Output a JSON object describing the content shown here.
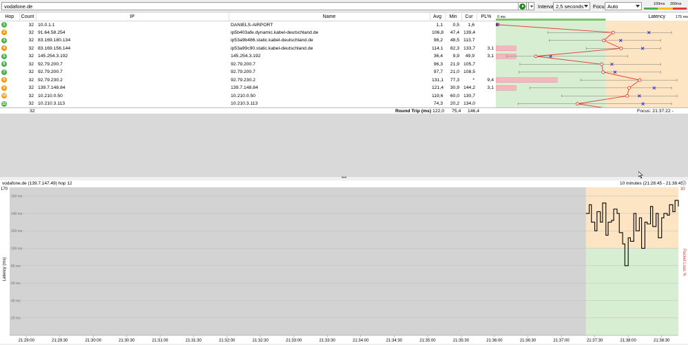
{
  "toolbar": {
    "target": "vodafone.de",
    "interval_label": "Interval",
    "interval_value": "2,5 seconds",
    "focus_label": "Focus",
    "focus_value": "Auto",
    "legend_100": "100ms",
    "legend_200": "200ms"
  },
  "columns": {
    "hop": "Hop",
    "count": "Count",
    "ip": "IP",
    "name": "Name",
    "avg": "Avg",
    "min": "Min",
    "cur": "Cur",
    "pl": "PL%",
    "latency": "Latency",
    "lat_min": "0 ms",
    "lat_max": "175 ms"
  },
  "hops": [
    {
      "hop": "1",
      "count": "32",
      "ip": "10.0.1.1",
      "name": "DANIELS-AIRPORT",
      "avg": "1,1",
      "min": "0,5",
      "cur": "1,6",
      "pl": "",
      "color": "#4caf50",
      "avg_v": 1.1,
      "min_v": 0.5,
      "cur_v": 1.6,
      "max_v": 3,
      "pl_v": 0
    },
    {
      "hop": "2",
      "count": "32",
      "ip": "91.64.58.254",
      "name": "ip5b403afe.dynamic.kabel-deutschland.de",
      "avg": "106,8",
      "min": "47,4",
      "cur": "139,4",
      "pl": "",
      "color": "#ff9800",
      "avg_v": 106.8,
      "min_v": 47.4,
      "cur_v": 139.4,
      "max_v": 160,
      "pl_v": 0
    },
    {
      "hop": "3",
      "count": "32",
      "ip": "83.169.180.134",
      "name": "ip53a9b486.static.kabel-deutschland.de",
      "avg": "98,2",
      "min": "48,5",
      "cur": "113,7",
      "pl": "",
      "color": "#4caf50",
      "avg_v": 98.2,
      "min_v": 48.5,
      "cur_v": 113.7,
      "max_v": 150,
      "pl_v": 0
    },
    {
      "hop": "4",
      "count": "32",
      "ip": "83.169.156.144",
      "name": "ip53a99c90.static.kabel-deutschland.de",
      "avg": "114,1",
      "min": "82,3",
      "cur": "133,7",
      "pl": "3,1",
      "color": "#ff9800",
      "avg_v": 114.1,
      "min_v": 82.3,
      "cur_v": 133.7,
      "max_v": 150,
      "pl_v": 3.1
    },
    {
      "hop": "5",
      "count": "32",
      "ip": "145.254.3.192",
      "name": "145.254.3.192",
      "avg": "36,4",
      "min": "9,9",
      "cur": "49,9",
      "pl": "3,1",
      "color": "#4caf50",
      "avg_v": 36.4,
      "min_v": 9.9,
      "cur_v": 49.9,
      "max_v": 120,
      "pl_v": 3.1
    },
    {
      "hop": "6",
      "count": "32",
      "ip": "92.79.200.7",
      "name": "92.79.200.7",
      "avg": "96,3",
      "min": "21,9",
      "cur": "105,7",
      "pl": "",
      "color": "#4caf50",
      "avg_v": 96.3,
      "min_v": 21.9,
      "cur_v": 105.7,
      "max_v": 150,
      "pl_v": 0
    },
    {
      "hop": "7",
      "count": "32",
      "ip": "92.79.200.7",
      "name": "92.79.200.7",
      "avg": "97,7",
      "min": "21,0",
      "cur": "108,5",
      "pl": "",
      "color": "#4caf50",
      "avg_v": 97.7,
      "min_v": 21.0,
      "cur_v": 108.5,
      "max_v": 150,
      "pl_v": 0
    },
    {
      "hop": "8",
      "count": "32",
      "ip": "92.79.230.2",
      "name": "92.79.230.2",
      "avg": "131,1",
      "min": "77,3",
      "cur": "*",
      "pl": "9,4",
      "color": "#ff9800",
      "avg_v": 131.1,
      "min_v": 77.3,
      "cur_v": null,
      "max_v": 165,
      "pl_v": 9.4
    },
    {
      "hop": "9",
      "count": "32",
      "ip": "139.7.148.84",
      "name": "139.7.148.84",
      "avg": "121,4",
      "min": "30,9",
      "cur": "144,2",
      "pl": "3,1",
      "color": "#ff9800",
      "avg_v": 121.4,
      "min_v": 30.9,
      "cur_v": 144.2,
      "max_v": 160,
      "pl_v": 3.1
    },
    {
      "hop": "10",
      "count": "32",
      "ip": "10.210.0.50",
      "name": "10.210.0.50",
      "avg": "119,6",
      "min": "60,0",
      "cur": "130,7",
      "pl": "",
      "color": "#ff9800",
      "avg_v": 119.6,
      "min_v": 60.0,
      "cur_v": 130.7,
      "max_v": 165,
      "pl_v": 0
    },
    {
      "hop": "11",
      "count": "32",
      "ip": "10.210.3.113",
      "name": "10.210.3.113",
      "avg": "74,3",
      "min": "20,2",
      "cur": "134,0",
      "pl": "",
      "color": "#4caf50",
      "avg_v": 74.3,
      "min_v": 20.2,
      "cur_v": 134.0,
      "max_v": 160,
      "pl_v": 0
    },
    {
      "hop": "12",
      "count": "32",
      "ip": "139.7.147.49",
      "name": "vodafone.de",
      "avg": "122,0",
      "min": "75,4",
      "cur": "146,4",
      "pl": "",
      "color": "#ff9800",
      "avg_v": 122.0,
      "min_v": 75.4,
      "cur_v": 146.4,
      "max_v": 165,
      "pl_v": 0
    }
  ],
  "summary": {
    "count": "32",
    "label": "Round Trip (ms)",
    "avg": "122,0",
    "min": "75,4",
    "cur": "146,4",
    "focus": "Focus: 21:37:22 - 21:38:45"
  },
  "chart_header": {
    "title": "vodafone.de (139.7.147.49) hop 12",
    "range": "10 minutes (21:28:45 - 21:38:45)"
  },
  "chart_data": {
    "type": "line",
    "ylabel": "Latency (ms)",
    "y2label": "Packet Loss %",
    "ylim": [
      0,
      170
    ],
    "y2max": "30",
    "ytop": "170",
    "yticks": [
      "160 ms",
      "140 ms",
      "120 ms",
      "100 ms",
      "80 ms",
      "60 ms",
      "40 ms",
      "20 ms"
    ],
    "ytick_values": [
      160,
      140,
      120,
      100,
      80,
      60,
      40,
      20
    ],
    "xticks": [
      "21:29:00",
      "21:29:30",
      "21:30:00",
      "21:30:30",
      "21:31:00",
      "21:31:30",
      "21:32:00",
      "21:32:30",
      "21:33:00",
      "21:33:30",
      "21:34:00",
      "21:34:30",
      "21:35:00",
      "21:35:30",
      "21:36:00",
      "21:36:30",
      "21:37:00",
      "21:37:30",
      "21:38:00",
      "21:38:30"
    ],
    "x_start": "21:28:45",
    "x_end": "21:38:45",
    "data_start": "21:37:22",
    "series": [
      {
        "x": [
          "21:37:22",
          "21:37:25",
          "21:37:27",
          "21:37:30",
          "21:37:32",
          "21:37:35",
          "21:37:37",
          "21:37:40",
          "21:37:42",
          "21:37:45",
          "21:37:47",
          "21:37:50",
          "21:37:52",
          "21:37:55",
          "21:37:57",
          "21:38:00",
          "21:38:02",
          "21:38:05",
          "21:38:07",
          "21:38:10",
          "21:38:12",
          "21:38:15",
          "21:38:17",
          "21:38:20",
          "21:38:22",
          "21:38:25",
          "21:38:27",
          "21:38:30",
          "21:38:32",
          "21:38:35",
          "21:38:37",
          "21:38:40",
          "21:38:42",
          "21:38:45"
        ],
        "values": [
          140,
          150,
          130,
          120,
          142,
          130,
          152,
          115,
          130,
          132,
          145,
          140,
          118,
          105,
          80,
          112,
          108,
          140,
          120,
          135,
          100,
          130,
          128,
          148,
          125,
          140,
          112,
          135,
          140,
          138,
          150,
          142,
          155,
          148
        ]
      }
    ]
  }
}
